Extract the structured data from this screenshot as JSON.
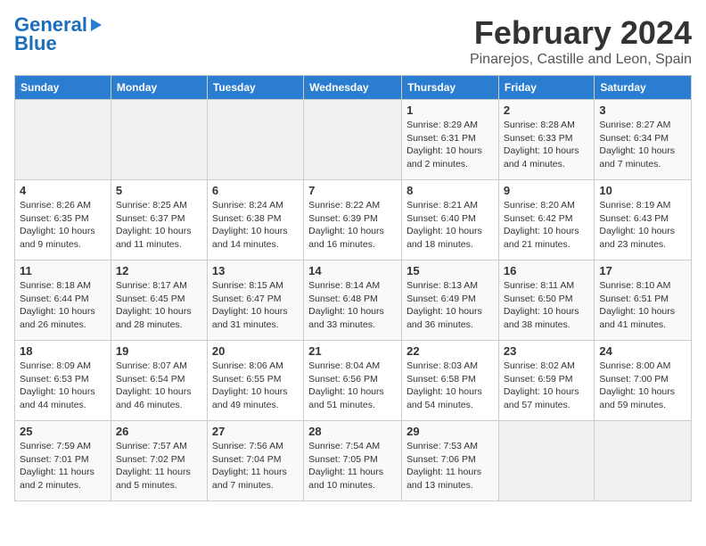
{
  "logo": {
    "top": "General",
    "arrow": "►",
    "bottom": "Blue"
  },
  "title": "February 2024",
  "subtitle": "Pinarejos, Castille and Leon, Spain",
  "headers": [
    "Sunday",
    "Monday",
    "Tuesday",
    "Wednesday",
    "Thursday",
    "Friday",
    "Saturday"
  ],
  "weeks": [
    [
      {
        "day": "",
        "info": ""
      },
      {
        "day": "",
        "info": ""
      },
      {
        "day": "",
        "info": ""
      },
      {
        "day": "",
        "info": ""
      },
      {
        "day": "1",
        "info": "Sunrise: 8:29 AM\nSunset: 6:31 PM\nDaylight: 10 hours\nand 2 minutes."
      },
      {
        "day": "2",
        "info": "Sunrise: 8:28 AM\nSunset: 6:33 PM\nDaylight: 10 hours\nand 4 minutes."
      },
      {
        "day": "3",
        "info": "Sunrise: 8:27 AM\nSunset: 6:34 PM\nDaylight: 10 hours\nand 7 minutes."
      }
    ],
    [
      {
        "day": "4",
        "info": "Sunrise: 8:26 AM\nSunset: 6:35 PM\nDaylight: 10 hours\nand 9 minutes."
      },
      {
        "day": "5",
        "info": "Sunrise: 8:25 AM\nSunset: 6:37 PM\nDaylight: 10 hours\nand 11 minutes."
      },
      {
        "day": "6",
        "info": "Sunrise: 8:24 AM\nSunset: 6:38 PM\nDaylight: 10 hours\nand 14 minutes."
      },
      {
        "day": "7",
        "info": "Sunrise: 8:22 AM\nSunset: 6:39 PM\nDaylight: 10 hours\nand 16 minutes."
      },
      {
        "day": "8",
        "info": "Sunrise: 8:21 AM\nSunset: 6:40 PM\nDaylight: 10 hours\nand 18 minutes."
      },
      {
        "day": "9",
        "info": "Sunrise: 8:20 AM\nSunset: 6:42 PM\nDaylight: 10 hours\nand 21 minutes."
      },
      {
        "day": "10",
        "info": "Sunrise: 8:19 AM\nSunset: 6:43 PM\nDaylight: 10 hours\nand 23 minutes."
      }
    ],
    [
      {
        "day": "11",
        "info": "Sunrise: 8:18 AM\nSunset: 6:44 PM\nDaylight: 10 hours\nand 26 minutes."
      },
      {
        "day": "12",
        "info": "Sunrise: 8:17 AM\nSunset: 6:45 PM\nDaylight: 10 hours\nand 28 minutes."
      },
      {
        "day": "13",
        "info": "Sunrise: 8:15 AM\nSunset: 6:47 PM\nDaylight: 10 hours\nand 31 minutes."
      },
      {
        "day": "14",
        "info": "Sunrise: 8:14 AM\nSunset: 6:48 PM\nDaylight: 10 hours\nand 33 minutes."
      },
      {
        "day": "15",
        "info": "Sunrise: 8:13 AM\nSunset: 6:49 PM\nDaylight: 10 hours\nand 36 minutes."
      },
      {
        "day": "16",
        "info": "Sunrise: 8:11 AM\nSunset: 6:50 PM\nDaylight: 10 hours\nand 38 minutes."
      },
      {
        "day": "17",
        "info": "Sunrise: 8:10 AM\nSunset: 6:51 PM\nDaylight: 10 hours\nand 41 minutes."
      }
    ],
    [
      {
        "day": "18",
        "info": "Sunrise: 8:09 AM\nSunset: 6:53 PM\nDaylight: 10 hours\nand 44 minutes."
      },
      {
        "day": "19",
        "info": "Sunrise: 8:07 AM\nSunset: 6:54 PM\nDaylight: 10 hours\nand 46 minutes."
      },
      {
        "day": "20",
        "info": "Sunrise: 8:06 AM\nSunset: 6:55 PM\nDaylight: 10 hours\nand 49 minutes."
      },
      {
        "day": "21",
        "info": "Sunrise: 8:04 AM\nSunset: 6:56 PM\nDaylight: 10 hours\nand 51 minutes."
      },
      {
        "day": "22",
        "info": "Sunrise: 8:03 AM\nSunset: 6:58 PM\nDaylight: 10 hours\nand 54 minutes."
      },
      {
        "day": "23",
        "info": "Sunrise: 8:02 AM\nSunset: 6:59 PM\nDaylight: 10 hours\nand 57 minutes."
      },
      {
        "day": "24",
        "info": "Sunrise: 8:00 AM\nSunset: 7:00 PM\nDaylight: 10 hours\nand 59 minutes."
      }
    ],
    [
      {
        "day": "25",
        "info": "Sunrise: 7:59 AM\nSunset: 7:01 PM\nDaylight: 11 hours\nand 2 minutes."
      },
      {
        "day": "26",
        "info": "Sunrise: 7:57 AM\nSunset: 7:02 PM\nDaylight: 11 hours\nand 5 minutes."
      },
      {
        "day": "27",
        "info": "Sunrise: 7:56 AM\nSunset: 7:04 PM\nDaylight: 11 hours\nand 7 minutes."
      },
      {
        "day": "28",
        "info": "Sunrise: 7:54 AM\nSunset: 7:05 PM\nDaylight: 11 hours\nand 10 minutes."
      },
      {
        "day": "29",
        "info": "Sunrise: 7:53 AM\nSunset: 7:06 PM\nDaylight: 11 hours\nand 13 minutes."
      },
      {
        "day": "",
        "info": ""
      },
      {
        "day": "",
        "info": ""
      }
    ]
  ]
}
